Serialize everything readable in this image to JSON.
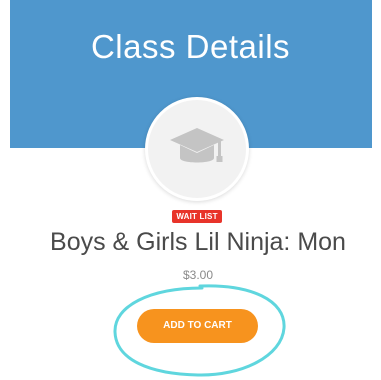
{
  "header": {
    "title": "Class Details",
    "background_color": "#4f97cd"
  },
  "class_card": {
    "image_icon": "graduation-cap-icon",
    "status_badge": "WAIT LIST",
    "status_color": "#e8342a",
    "name": "Boys & Girls Lil Ninja: Mon",
    "price": "$3.00"
  },
  "actions": {
    "add_to_cart_label": "ADD TO CART",
    "add_to_cart_color": "#f7931e"
  },
  "annotation": {
    "highlight_color": "#5fd6de"
  }
}
